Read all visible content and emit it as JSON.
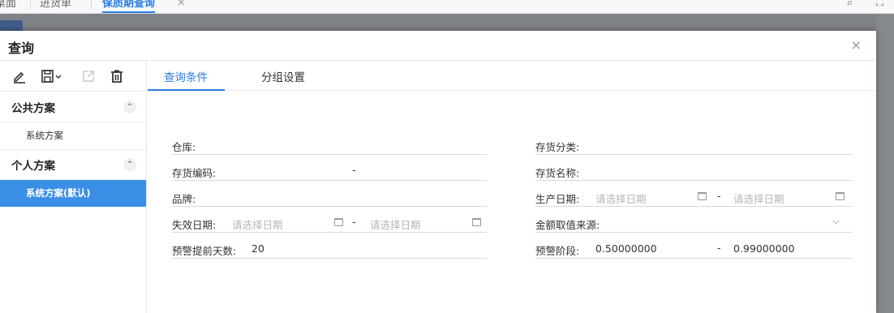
{
  "background": {
    "tabs": [
      {
        "label": "桌面",
        "active": false
      },
      {
        "label": "进货单",
        "active": false
      },
      {
        "label": "保质期查询",
        "active": true
      }
    ],
    "tab_close": "×"
  },
  "dialog": {
    "title": "查询",
    "close": "×",
    "toolbar": [
      {
        "icon": "edit-icon"
      },
      {
        "icon": "save-dropdown-icon"
      },
      {
        "icon": "export-icon",
        "disabled": true
      },
      {
        "icon": "delete-icon"
      }
    ],
    "groups": [
      {
        "title": "公共方案",
        "caret": "⌃",
        "items": [
          {
            "label": "系统方案",
            "active": false
          }
        ]
      },
      {
        "title": "个人方案",
        "caret": "⌃",
        "items": [
          {
            "label": "系统方案(默认)",
            "active": true
          }
        ]
      }
    ],
    "tabs": [
      {
        "label": "查询条件",
        "active": true
      },
      {
        "label": "分组设置",
        "active": false
      }
    ],
    "fields": {
      "warehouse": {
        "label": "仓库:",
        "value": ""
      },
      "inventory_category": {
        "label": "存货分类:",
        "value": ""
      },
      "inventory_code": {
        "label": "存货编码:",
        "from": "",
        "sep": "-",
        "to": ""
      },
      "inventory_name": {
        "label": "存货名称:",
        "value": ""
      },
      "brand": {
        "label": "品牌:",
        "value": ""
      },
      "production_date": {
        "label": "生产日期:",
        "from_placeholder": "请选择日期",
        "sep": "-",
        "to_placeholder": "请选择日期"
      },
      "expiry_date": {
        "label": "失效日期:",
        "from_placeholder": "请选择日期",
        "sep": "-",
        "to_placeholder": "请选择日期"
      },
      "amount_source": {
        "label": "金额取值来源:",
        "value": ""
      },
      "warning_days": {
        "label": "预警提前天数:",
        "value": "20"
      },
      "warning_stage": {
        "label": "预警阶段:",
        "from": "0.50000000",
        "sep": "-",
        "to": "0.99000000"
      }
    }
  },
  "colors": {
    "accent": "#2a7de1",
    "active_scheme_bg": "#3a8ee6"
  }
}
